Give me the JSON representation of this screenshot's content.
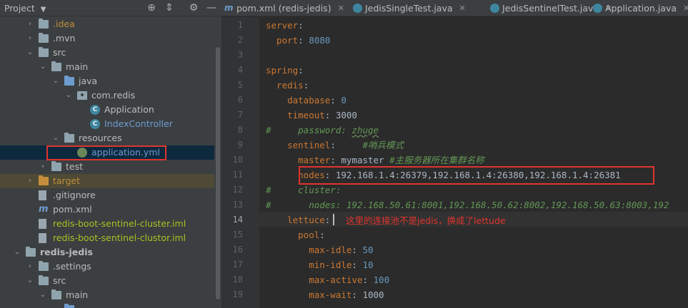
{
  "project_panel": {
    "title": "Project",
    "tree": [
      {
        "label": ".idea",
        "kind": "folder",
        "color": "orange",
        "arrow": "›",
        "indent": 1
      },
      {
        "label": ".mvn",
        "kind": "folder",
        "color": "white",
        "arrow": "›",
        "indent": 1
      },
      {
        "label": "src",
        "kind": "folder",
        "color": "white",
        "arrow": "⌄",
        "indent": 1
      },
      {
        "label": "main",
        "kind": "folder",
        "color": "white",
        "arrow": "⌄",
        "indent": 2
      },
      {
        "label": "java",
        "kind": "folder-blue",
        "color": "white",
        "arrow": "⌄",
        "indent": 3
      },
      {
        "label": "com.redis",
        "kind": "package",
        "color": "white",
        "arrow": "⌄",
        "indent": 4
      },
      {
        "label": "Application",
        "kind": "class",
        "color": "white",
        "arrow": "",
        "indent": 5
      },
      {
        "label": "IndexController",
        "kind": "class",
        "color": "blue",
        "arrow": "",
        "indent": 5
      },
      {
        "label": "resources",
        "kind": "folder",
        "color": "white",
        "arrow": "⌄",
        "indent": 3
      },
      {
        "label": "application.yml",
        "kind": "yml",
        "color": "blue",
        "arrow": "",
        "indent": 4,
        "selected": true
      },
      {
        "label": "test",
        "kind": "folder",
        "color": "white",
        "arrow": "›",
        "indent": 2
      },
      {
        "label": "target",
        "kind": "folder-orange",
        "color": "orange",
        "arrow": "›",
        "indent": 1,
        "highlight": true
      },
      {
        "label": ".gitignore",
        "kind": "file",
        "color": "white",
        "arrow": "",
        "indent": 1
      },
      {
        "label": "pom.xml",
        "kind": "maven",
        "color": "white",
        "arrow": "",
        "indent": 1
      },
      {
        "label": "redis-boot-sentinel-cluster.iml",
        "kind": "file",
        "color": "green",
        "arrow": "",
        "indent": 1
      },
      {
        "label": "redis-boot-sentinel-clustor.iml",
        "kind": "file",
        "color": "green",
        "arrow": "",
        "indent": 1
      },
      {
        "label": "redis-jedis",
        "kind": "folder",
        "color": "bold",
        "arrow": "⌄",
        "indent": 0
      },
      {
        "label": ".settings",
        "kind": "folder",
        "color": "white",
        "arrow": "›",
        "indent": 1
      },
      {
        "label": "src",
        "kind": "folder",
        "color": "white",
        "arrow": "⌄",
        "indent": 1
      },
      {
        "label": "main",
        "kind": "folder",
        "color": "white",
        "arrow": "⌄",
        "indent": 2
      },
      {
        "label": "",
        "kind": "folder-blue",
        "color": "white",
        "arrow": "⌄",
        "indent": 3
      }
    ]
  },
  "tabs": [
    {
      "label": "pom.xml (redis-jedis)",
      "icon": "maven-icon"
    },
    {
      "label": "JedisSingleTest.java",
      "icon": "class-icon"
    },
    {
      "label": "JedisSentinelTest.java",
      "icon": "class-icon"
    },
    {
      "label": "Application.java",
      "icon": "class-icon"
    }
  ],
  "editor": {
    "line_numbers": [
      "1",
      "2",
      "3",
      "4",
      "5",
      "6",
      "7",
      "8",
      "9",
      "10",
      "11",
      "12",
      "13",
      "14",
      "15",
      "16",
      "17",
      "18",
      "19"
    ],
    "current_line": "14",
    "lines": [
      [
        {
          "t": "server",
          "c": "k"
        },
        {
          "t": ":",
          "c": "s"
        }
      ],
      [
        {
          "t": "  port",
          "c": "k"
        },
        {
          "t": ": ",
          "c": "s"
        },
        {
          "t": "8080",
          "c": "v"
        }
      ],
      [],
      [
        {
          "t": "spring",
          "c": "k"
        },
        {
          "t": ":",
          "c": "s"
        }
      ],
      [
        {
          "t": "  redis",
          "c": "k"
        },
        {
          "t": ":",
          "c": "s"
        }
      ],
      [
        {
          "t": "    database",
          "c": "k"
        },
        {
          "t": ": ",
          "c": "s"
        },
        {
          "t": "0",
          "c": "v"
        }
      ],
      [
        {
          "t": "    timeout",
          "c": "k"
        },
        {
          "t": ": ",
          "c": "s"
        },
        {
          "t": "3000",
          "c": "s"
        }
      ],
      [
        {
          "t": "#     password: ",
          "c": "cm"
        },
        {
          "t": "zhuge",
          "c": "cmu"
        }
      ],
      [
        {
          "t": "    sentinel",
          "c": "k"
        },
        {
          "t": ":     ",
          "c": "s"
        },
        {
          "t": "#哨兵模式",
          "c": "cm"
        }
      ],
      [
        {
          "t": "      master",
          "c": "k"
        },
        {
          "t": ": mymaster ",
          "c": "s"
        },
        {
          "t": "#主服务器所在集群名称",
          "c": "cm"
        }
      ],
      [
        {
          "t": "      nodes",
          "c": "k"
        },
        {
          "t": ": 192.168.1.4:26379,192.168.1.4:26380,192.168.1.4:26381",
          "c": "s"
        }
      ],
      [
        {
          "t": "#     cluster:",
          "c": "cm"
        }
      ],
      [
        {
          "t": "#       nodes: 192.168.50.61:8001,192.168.50.62:8002,192.168.50.63:8003,192",
          "c": "cm"
        }
      ],
      [
        {
          "t": "    lettuce",
          "c": "k"
        },
        {
          "t": ":",
          "c": "s"
        }
      ],
      [
        {
          "t": "      pool",
          "c": "k"
        },
        {
          "t": ":",
          "c": "s"
        }
      ],
      [
        {
          "t": "        max-idle",
          "c": "k"
        },
        {
          "t": ": ",
          "c": "s"
        },
        {
          "t": "50",
          "c": "v"
        }
      ],
      [
        {
          "t": "        min-idle",
          "c": "k"
        },
        {
          "t": ": ",
          "c": "s"
        },
        {
          "t": "10",
          "c": "v"
        }
      ],
      [
        {
          "t": "        max-active",
          "c": "k"
        },
        {
          "t": ": ",
          "c": "s"
        },
        {
          "t": "100",
          "c": "v"
        }
      ],
      [
        {
          "t": "        max-wait",
          "c": "k"
        },
        {
          "t": ": ",
          "c": "s"
        },
        {
          "t": "1000",
          "c": "s"
        }
      ]
    ]
  },
  "annotation": "这里的连接池不是jedis，换成了lettude",
  "colors": {
    "highlight_box": "#e0342e",
    "selection": "#0d293e",
    "keyword": "#cc7832",
    "number": "#6897bb",
    "comment": "#629755"
  }
}
